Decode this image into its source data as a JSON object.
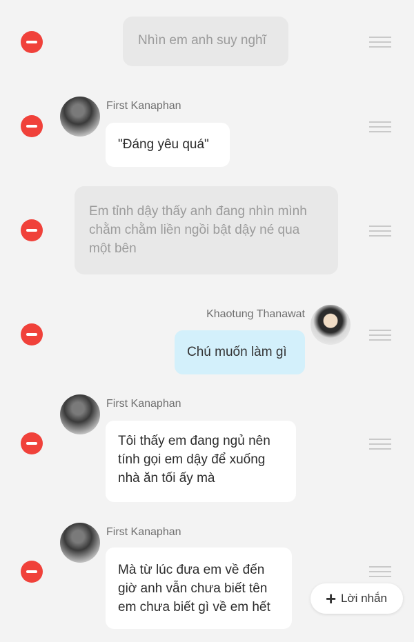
{
  "messages": [
    {
      "type": "narration",
      "text": "Nhìn em anh suy nghĩ"
    },
    {
      "type": "message",
      "sender": "First Kanaphan",
      "text": "\"Đáng yêu quá\""
    },
    {
      "type": "narration",
      "lines": [
        "Em tỉnh dậy thấy anh đang nhìn mình",
        "chằm chằm liền ngồi bật dậy né qua",
        "một bên"
      ]
    },
    {
      "type": "message",
      "sender": "Khaotung Thanawat",
      "text": "Chú muốn làm gì"
    },
    {
      "type": "message",
      "sender": "First Kanaphan",
      "lines": [
        "Tôi thấy em đang ngủ nên",
        "tính gọi em dậy để xuống",
        "nhà ăn tối ấy mà"
      ]
    },
    {
      "type": "message",
      "sender": "First Kanaphan",
      "lines": [
        "Mà từ lúc đưa em về đến",
        "giờ anh vẫn chưa biết tên",
        "em chưa biết gì về em hết"
      ]
    }
  ],
  "add_button": {
    "icon": "plus-icon",
    "label": "Lời nhắn"
  },
  "colors": {
    "delete": "#f0413a",
    "outgoing_bubble": "#d3f0fb",
    "narration_bg": "#e8e8e8"
  }
}
